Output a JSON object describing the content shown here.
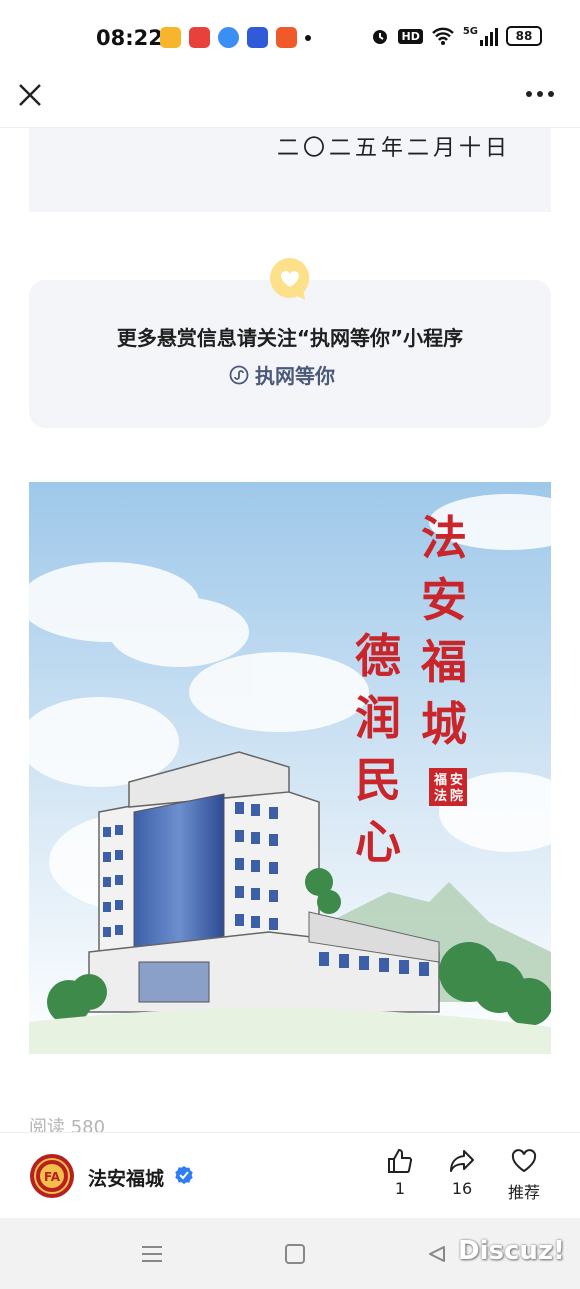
{
  "status_bar": {
    "time": "08:22",
    "app_icons": [
      {
        "name": "video-app-icon",
        "color": "#f7b52c"
      },
      {
        "name": "toutiao-app-icon",
        "color": "#e8413c"
      },
      {
        "name": "feather-app-icon",
        "color": "#3a8ef5"
      },
      {
        "name": "baidu-app-icon",
        "color": "#2f5bd8"
      },
      {
        "name": "play-app-icon",
        "color": "#f05a28"
      }
    ],
    "hd_label": "HD",
    "network_label": "5G",
    "battery_level": "88"
  },
  "article": {
    "date_text": "二〇二五年二月十日",
    "promo": {
      "text": "更多悬赏信息请关注“执网等你”小程序",
      "link_label": "执网等你"
    },
    "poster": {
      "calligraphy_line1": "法安福城",
      "calligraphy_line2": "德润民心",
      "seal_text": "福安法院"
    },
    "read_count": "阅读 580"
  },
  "bottom_bar": {
    "account_name": "法安福城",
    "avatar_text": "FA",
    "like_count": "1",
    "share_count": "16",
    "recommend_label": "推荐"
  },
  "watermark": "Discuz!",
  "colors": {
    "card_bg": "#f3f5f9",
    "link_color": "#4b5a79",
    "heart_badge": "#fde08a",
    "seal_red": "#c9262b",
    "verified_blue": "#2e7cf6"
  }
}
